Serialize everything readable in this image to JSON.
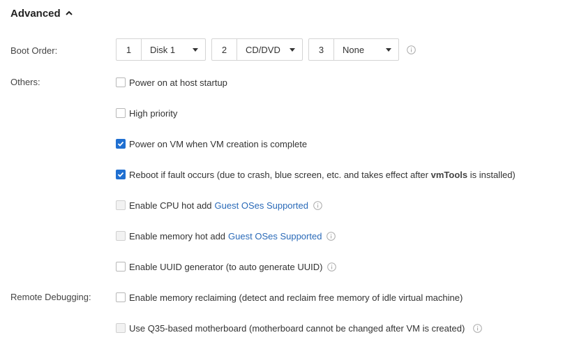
{
  "section": {
    "title": "Advanced"
  },
  "labels": {
    "boot_order": "Boot Order:",
    "others": "Others:",
    "remote_debugging": "Remote Debugging:"
  },
  "boot_order": [
    {
      "index": "1",
      "value": "Disk 1"
    },
    {
      "index": "2",
      "value": "CD/DVD"
    },
    {
      "index": "3",
      "value": "None"
    }
  ],
  "options": {
    "power_on_startup": {
      "label": "Power on at host startup",
      "checked": false
    },
    "high_priority": {
      "label": "High priority",
      "checked": false
    },
    "power_on_vm": {
      "label": "Power on VM when VM creation is complete",
      "checked": true
    },
    "reboot_fault": {
      "label_pre": "Reboot if fault occurs (due to crash, blue screen, etc. and takes effect after ",
      "label_bold": "vmTools",
      "label_post": " is installed)",
      "checked": true
    },
    "cpu_hot_add": {
      "label": "Enable CPU hot add",
      "link": "Guest OSes Supported",
      "checked": false,
      "disabled": true
    },
    "memory_hot_add": {
      "label": "Enable memory hot add",
      "link": "Guest OSes Supported",
      "checked": false,
      "disabled": true
    },
    "uuid_generator": {
      "label": "Enable UUID generator (to auto generate UUID)",
      "checked": false
    },
    "memory_reclaiming": {
      "label": "Enable memory reclaiming (detect and reclaim free memory of idle virtual machine)",
      "checked": false
    },
    "q35_motherboard": {
      "label": "Use Q35-based motherboard (motherboard cannot be changed after VM is created)",
      "checked": false,
      "disabled": true
    }
  },
  "colors": {
    "checked": "#1f6fd1",
    "link": "#2a6ab8"
  }
}
